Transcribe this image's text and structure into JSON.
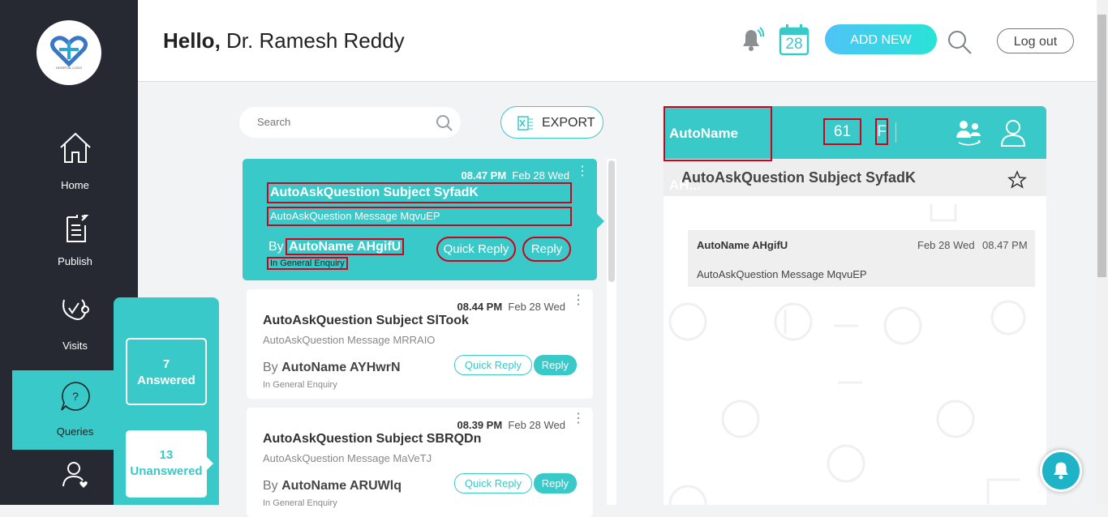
{
  "sidebar": {
    "logo_text": "HOSPITAL LOGO",
    "items": [
      {
        "label": "Home",
        "icon": "home-icon"
      },
      {
        "label": "Publish",
        "icon": "publish-icon"
      },
      {
        "label": "Visits",
        "icon": "stethoscope-icon"
      },
      {
        "label": "Queries",
        "icon": "question-bubble-icon"
      },
      {
        "label": "",
        "icon": "user-heart-icon"
      }
    ]
  },
  "subpanel": {
    "answered_count": "7",
    "answered_label": "Answered",
    "unanswered_count": "13",
    "unanswered_label": "Unanswered"
  },
  "header": {
    "greeting": "Hello,",
    "user_name": "Dr. Ramesh Reddy",
    "calendar_day": "28",
    "add_new_label": "ADD NEW",
    "logout_label": "Log out"
  },
  "list": {
    "search_placeholder": "Search",
    "export_label": "EXPORT",
    "by_prefix": "By",
    "cards": [
      {
        "time": "08.47 PM",
        "date": "Feb 28 Wed",
        "subject": "AutoAskQuestion Subject SyfadK",
        "message": "AutoAskQuestion Message MqvuEP",
        "author": "AutoName AHgifU",
        "category": "In General Enquiry",
        "quick_reply": "Quick Reply",
        "reply": "Reply"
      },
      {
        "time": "08.44 PM",
        "date": "Feb 28 Wed",
        "subject": "AutoAskQuestion Subject SlTook",
        "message": "AutoAskQuestion Message MRRAIO",
        "author": "AutoName AYHwrN",
        "category": "In General Enquiry",
        "quick_reply": "Quick Reply",
        "reply": "Reply"
      },
      {
        "time": "08.39 PM",
        "date": "Feb 28 Wed",
        "subject": "AutoAskQuestion Subject SBRQDn",
        "message": "AutoAskQuestion Message MaVeTJ",
        "author": "AutoName ARUWlq",
        "category": "In General Enquiry",
        "quick_reply": "Quick Reply",
        "reply": "Reply"
      }
    ]
  },
  "detail": {
    "patient_name": "AutoName AH...",
    "age": "61",
    "gender": "F",
    "subject": "AutoAskQuestion Subject SyfadK",
    "message_author": "AutoName AHgifU",
    "message_date": "Feb 28 Wed",
    "message_time": "08.47 PM",
    "message_text": "AutoAskQuestion Message MqvuEP"
  },
  "colors": {
    "accent": "#39c9c9",
    "sidebar": "#262931",
    "highlight": "#d0021b"
  }
}
